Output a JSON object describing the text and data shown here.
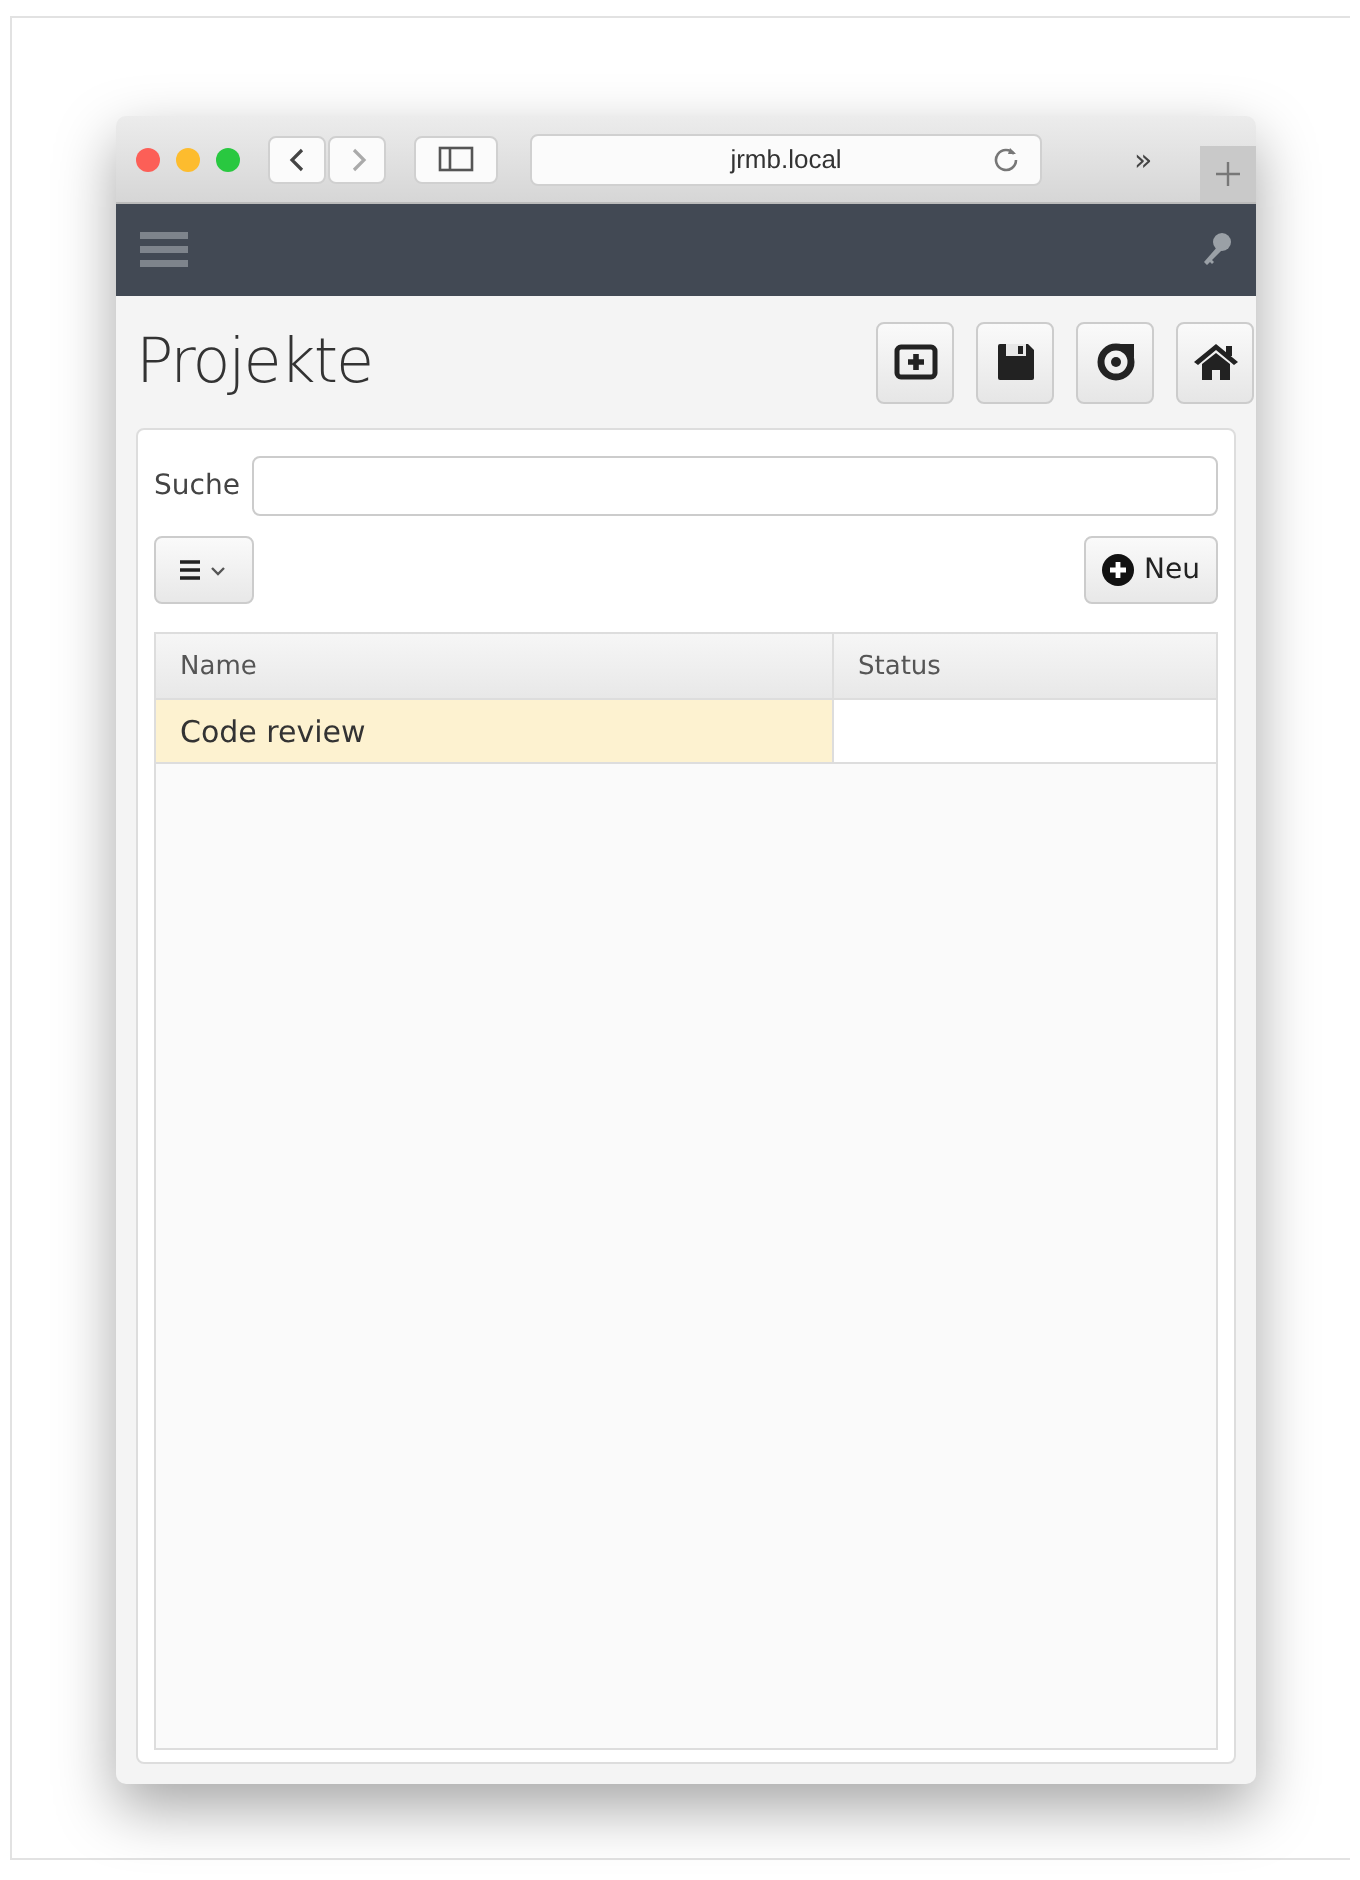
{
  "browser": {
    "address": "jrmb.local",
    "overflow": "»"
  },
  "page": {
    "title": "Projekte"
  },
  "search": {
    "label": "Suche"
  },
  "new_button": {
    "label": "Neu"
  },
  "table": {
    "columns": [
      "Name",
      "Status"
    ],
    "rows": [
      {
        "name": "Code review",
        "selected": true
      }
    ]
  }
}
